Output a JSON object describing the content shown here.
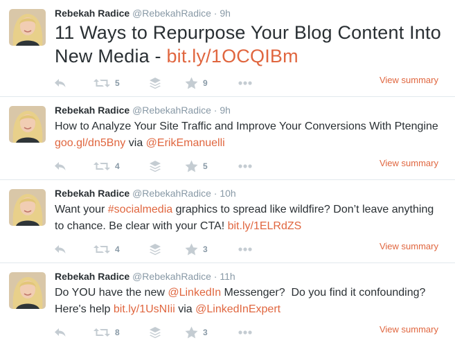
{
  "tweets": [
    {
      "name": "Rebekah Radice",
      "handle": "@RebekahRadice",
      "dot": "·",
      "time": "9h",
      "text_before": "11 Ways to Repurpose Your Blog Content Into New Media - ",
      "link1": "bit.ly/1OCQIBm",
      "text_middle": "",
      "link2": "",
      "text_after": "",
      "link3": "",
      "retweets": "5",
      "favorites": "9",
      "view_summary": "View summary"
    },
    {
      "name": "Rebekah Radice",
      "handle": "@RebekahRadice",
      "dot": "·",
      "time": "9h",
      "text_before": "How to Analyze Your Site Traffic and Improve Your Conversions With Ptengine ",
      "link1": "goo.gl/dn5Bny",
      "text_middle": " via ",
      "link2": "@ErikEmanuelli",
      "text_after": "",
      "link3": "",
      "retweets": "4",
      "favorites": "5",
      "view_summary": "View summary"
    },
    {
      "name": "Rebekah Radice",
      "handle": "@RebekahRadice",
      "dot": "·",
      "time": "10h",
      "text_before": "Want your ",
      "link1": "#socialmedia",
      "text_middle": " graphics to spread like wildfire? Don’t leave anything to chance. Be clear with your CTA! ",
      "link2": "bit.ly/1ELRdZS",
      "text_after": "",
      "link3": "",
      "retweets": "4",
      "favorites": "3",
      "view_summary": "View summary"
    },
    {
      "name": "Rebekah Radice",
      "handle": "@RebekahRadice",
      "dot": "·",
      "time": "11h",
      "text_before": "Do YOU have the new ",
      "link1": "@LinkedIn",
      "text_middle": " Messenger?  Do you find it confounding? Here's help ",
      "link2": "bit.ly/1UsNIii",
      "text_after": " via ",
      "link3": "@LinkedInExpert",
      "retweets": "8",
      "favorites": "3",
      "view_summary": "View summary"
    }
  ],
  "colors": {
    "accent": "#e0663f",
    "muted": "#8899a6",
    "icon": "#c4ccd2",
    "text": "#292f33"
  },
  "icons": [
    "reply-icon",
    "retweet-icon",
    "buffer-icon",
    "favorite-icon",
    "more-icon"
  ]
}
